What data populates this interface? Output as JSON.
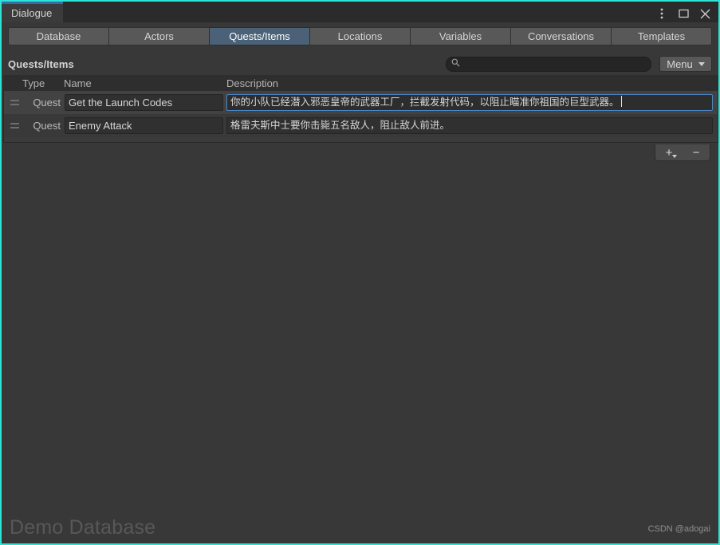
{
  "window": {
    "title": "Dialogue",
    "controls": [
      {
        "name": "kebab-menu-icon",
        "label": "⋮"
      },
      {
        "name": "maximize-icon",
        "label": "❐"
      },
      {
        "name": "close-icon",
        "label": "✕"
      }
    ]
  },
  "tabs": [
    {
      "label": "Database",
      "selected": false
    },
    {
      "label": "Actors",
      "selected": false
    },
    {
      "label": "Quests/Items",
      "selected": true
    },
    {
      "label": "Locations",
      "selected": false
    },
    {
      "label": "Variables",
      "selected": false
    },
    {
      "label": "Conversations",
      "selected": false
    },
    {
      "label": "Templates",
      "selected": false
    }
  ],
  "toolbar": {
    "section_title": "Quests/Items",
    "search_value": "",
    "search_placeholder": "",
    "menu_label": "Menu"
  },
  "list": {
    "headers": {
      "type": "Type",
      "name": "Name",
      "description": "Description"
    },
    "rows": [
      {
        "type": "Quest",
        "name": "Get the Launch Codes",
        "description": "你的小队已经潜入邪恶皇帝的武器工厂，拦截发射代码，以阻止瞄准你祖国的巨型武器。",
        "focused": true
      },
      {
        "type": "Quest",
        "name": "Enemy Attack",
        "description": "格雷夫斯中士要你击毙五名敌人，阻止敌人前进。",
        "focused": false
      }
    ],
    "footer": {
      "add_label": "+",
      "remove_label": "−"
    }
  },
  "watermarks": {
    "database_name": "Demo Database",
    "credit": "CSDN @adogai"
  },
  "colors": {
    "window_border": "#2fe3d4",
    "selected_tab": "#4a6178",
    "title_accent": "#2f6ea8",
    "focus_outline": "#4b86c4",
    "panel_background": "#383838"
  }
}
